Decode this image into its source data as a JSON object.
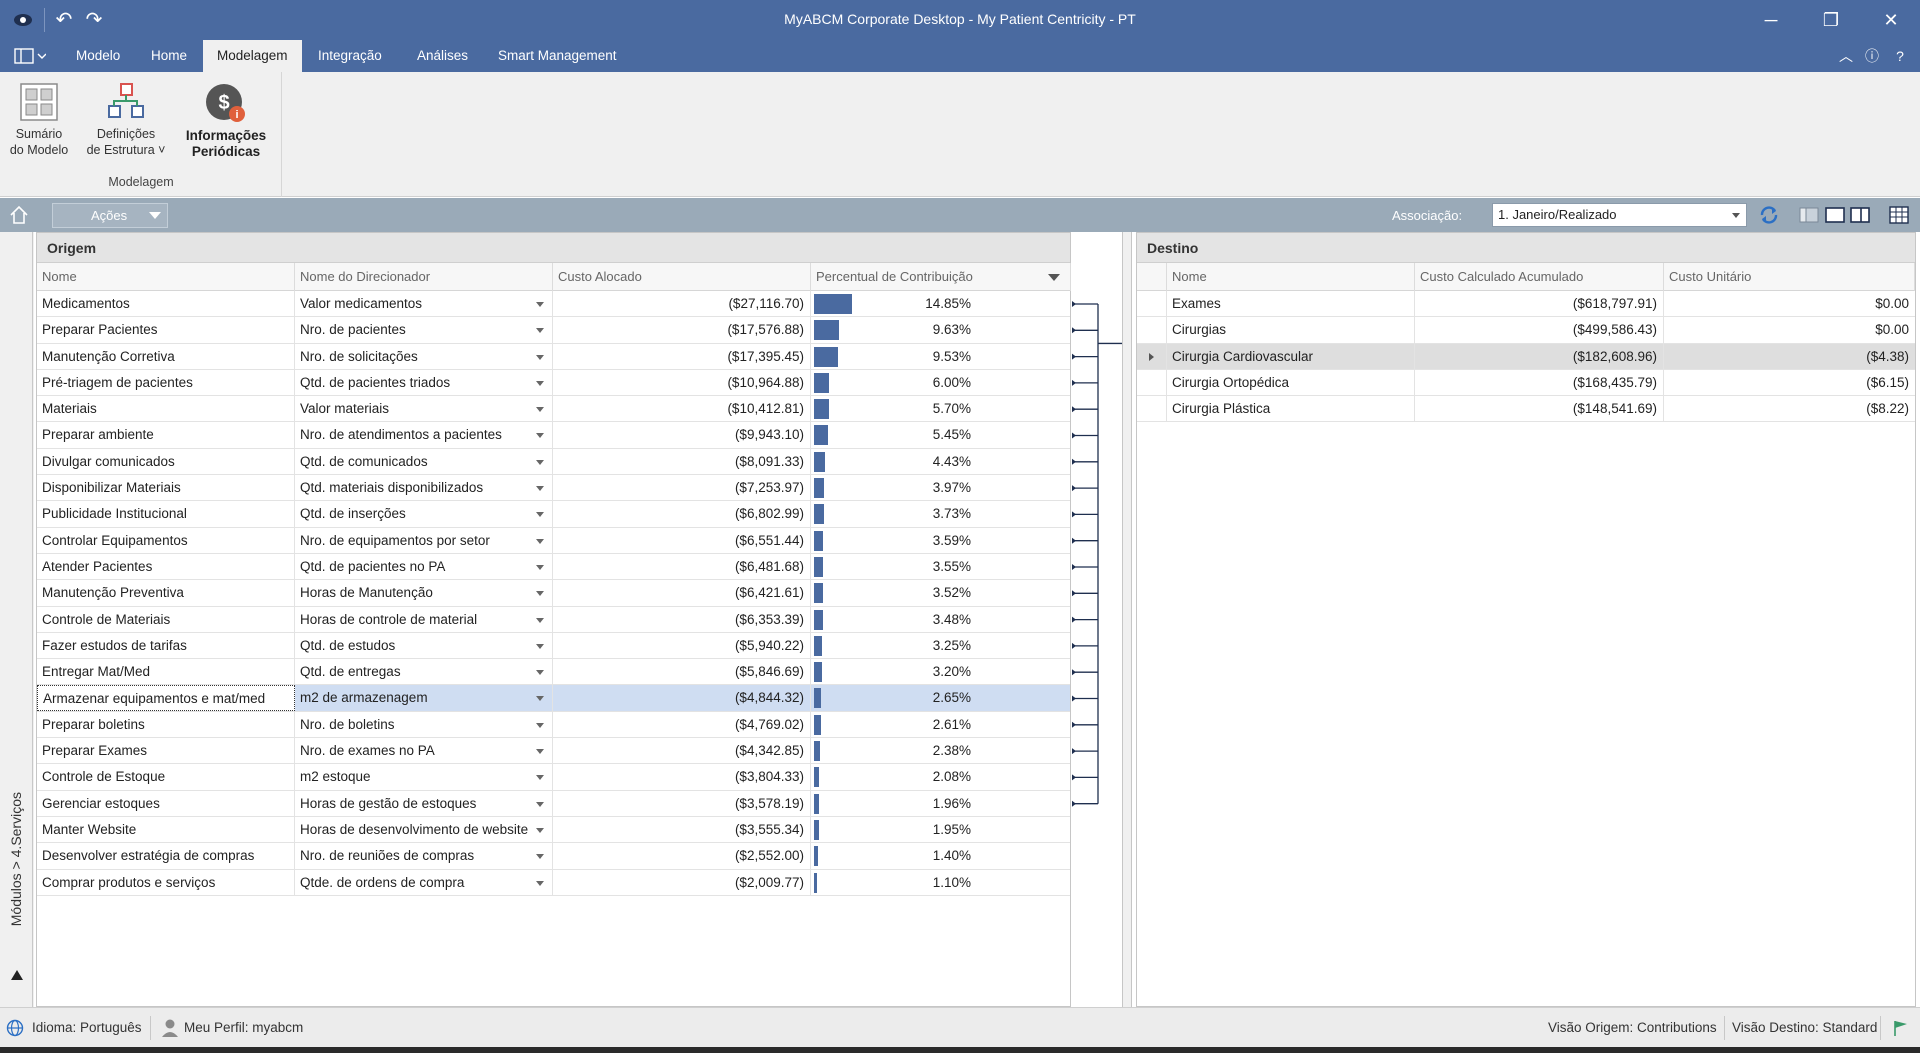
{
  "window": {
    "title": "MyABCM Corporate Desktop - My Patient Centricity - PT"
  },
  "menu": {
    "tabs": [
      "Modelo",
      "Home",
      "Modelagem",
      "Integração",
      "Análises",
      "Smart Management"
    ],
    "active": "Modelagem"
  },
  "ribbon": {
    "buttons": [
      {
        "line1": "Sumário",
        "line2": "do Modelo"
      },
      {
        "line1": "Definições",
        "line2": "de Estrutura ˅"
      },
      {
        "line1": "Informações",
        "line2": "Periódicas"
      }
    ],
    "group_label": "Modelagem"
  },
  "actionbar": {
    "acoes_label": "Ações",
    "associacao_label": "Associação:",
    "associacao_value": "1. Janeiro/Realizado"
  },
  "sidebar": {
    "label": "Módulos > 4.Serviços"
  },
  "origem": {
    "title": "Origem",
    "columns": [
      "Nome",
      "Nome do Direcionador",
      "Custo Alocado",
      "Percentual de Contribuição"
    ],
    "rows": [
      {
        "nome": "Medicamentos",
        "direcionador": "Valor medicamentos",
        "custo": "($27,116.70)",
        "pct": "14.85%",
        "pct_value": 14.85
      },
      {
        "nome": "Preparar Pacientes",
        "direcionador": "Nro. de pacientes",
        "custo": "($17,576.88)",
        "pct": "9.63%",
        "pct_value": 9.63
      },
      {
        "nome": "Manutenção Corretiva",
        "direcionador": "Nro. de solicitações",
        "custo": "($17,395.45)",
        "pct": "9.53%",
        "pct_value": 9.53
      },
      {
        "nome": "Pré-triagem de pacientes",
        "direcionador": "Qtd. de pacientes triados",
        "custo": "($10,964.88)",
        "pct": "6.00%",
        "pct_value": 6.0
      },
      {
        "nome": "Materiais",
        "direcionador": "Valor materiais",
        "custo": "($10,412.81)",
        "pct": "5.70%",
        "pct_value": 5.7
      },
      {
        "nome": "Preparar ambiente",
        "direcionador": "Nro. de atendimentos a pacientes",
        "custo": "($9,943.10)",
        "pct": "5.45%",
        "pct_value": 5.45
      },
      {
        "nome": "Divulgar comunicados",
        "direcionador": "Qtd. de comunicados",
        "custo": "($8,091.33)",
        "pct": "4.43%",
        "pct_value": 4.43
      },
      {
        "nome": "Disponibilizar Materiais",
        "direcionador": "Qtd. materiais disponibilizados",
        "custo": "($7,253.97)",
        "pct": "3.97%",
        "pct_value": 3.97
      },
      {
        "nome": "Publicidade Institucional",
        "direcionador": "Qtd. de inserções",
        "custo": "($6,802.99)",
        "pct": "3.73%",
        "pct_value": 3.73
      },
      {
        "nome": "Controlar Equipamentos",
        "direcionador": "Nro. de equipamentos por setor",
        "custo": "($6,551.44)",
        "pct": "3.59%",
        "pct_value": 3.59
      },
      {
        "nome": "Atender Pacientes",
        "direcionador": "Qtd. de pacientes no PA",
        "custo": "($6,481.68)",
        "pct": "3.55%",
        "pct_value": 3.55
      },
      {
        "nome": "Manutenção Preventiva",
        "direcionador": "Horas de Manutenção",
        "custo": "($6,421.61)",
        "pct": "3.52%",
        "pct_value": 3.52
      },
      {
        "nome": "Controle de Materiais",
        "direcionador": "Horas de controle de material",
        "custo": "($6,353.39)",
        "pct": "3.48%",
        "pct_value": 3.48
      },
      {
        "nome": "Fazer estudos de tarifas",
        "direcionador": "Qtd. de estudos",
        "custo": "($5,940.22)",
        "pct": "3.25%",
        "pct_value": 3.25
      },
      {
        "nome": "Entregar Mat/Med",
        "direcionador": "Qtd. de entregas",
        "custo": "($5,846.69)",
        "pct": "3.20%",
        "pct_value": 3.2
      },
      {
        "nome": "Armazenar equipamentos e mat/med",
        "direcionador": "m2 de armazenagem",
        "custo": "($4,844.32)",
        "pct": "2.65%",
        "pct_value": 2.65,
        "selected": true
      },
      {
        "nome": "Preparar boletins",
        "direcionador": "Nro. de boletins",
        "custo": "($4,769.02)",
        "pct": "2.61%",
        "pct_value": 2.61
      },
      {
        "nome": "Preparar Exames",
        "direcionador": "Nro. de exames no PA",
        "custo": "($4,342.85)",
        "pct": "2.38%",
        "pct_value": 2.38
      },
      {
        "nome": "Controle de Estoque",
        "direcionador": "m2 estoque",
        "custo": "($3,804.33)",
        "pct": "2.08%",
        "pct_value": 2.08
      },
      {
        "nome": "Gerenciar estoques",
        "direcionador": "Horas de gestão de estoques",
        "custo": "($3,578.19)",
        "pct": "1.96%",
        "pct_value": 1.96
      },
      {
        "nome": "Manter Website",
        "direcionador": "Horas de desenvolvimento de website",
        "custo": "($3,555.34)",
        "pct": "1.95%",
        "pct_value": 1.95
      },
      {
        "nome": "Desenvolver estratégia de compras",
        "direcionador": "Nro. de reuniões de compras",
        "custo": "($2,552.00)",
        "pct": "1.40%",
        "pct_value": 1.4
      },
      {
        "nome": "Comprar produtos e serviços",
        "direcionador": "Qtde. de ordens de compra",
        "custo": "($2,009.77)",
        "pct": "1.10%",
        "pct_value": 1.1
      }
    ]
  },
  "destino": {
    "title": "Destino",
    "columns": [
      "Nome",
      "Custo Calculado Acumulado",
      "Custo Unitário"
    ],
    "rows": [
      {
        "nome": "Exames",
        "custo_acum": "($618,797.91)",
        "custo_unit": "$0.00"
      },
      {
        "nome": "Cirurgias",
        "custo_acum": "($499,586.43)",
        "custo_unit": "$0.00"
      },
      {
        "nome": "Cirurgia Cardiovascular",
        "custo_acum": "($182,608.96)",
        "custo_unit": "($4.38)",
        "selected": true
      },
      {
        "nome": "Cirurgia Ortopédica",
        "custo_acum": "($168,435.79)",
        "custo_unit": "($6.15)"
      },
      {
        "nome": "Cirurgia Plástica",
        "custo_acum": "($148,541.69)",
        "custo_unit": "($8.22)"
      }
    ]
  },
  "statusbar": {
    "idioma": "Idioma: Português",
    "perfil": "Meu Perfil: myabcm",
    "visao_origem": "Visão Origem: Contributions",
    "visao_destino": "Visão Destino: Standard"
  },
  "colors": {
    "accent": "#4a6aa0",
    "actionbar": "#9aaab8"
  }
}
